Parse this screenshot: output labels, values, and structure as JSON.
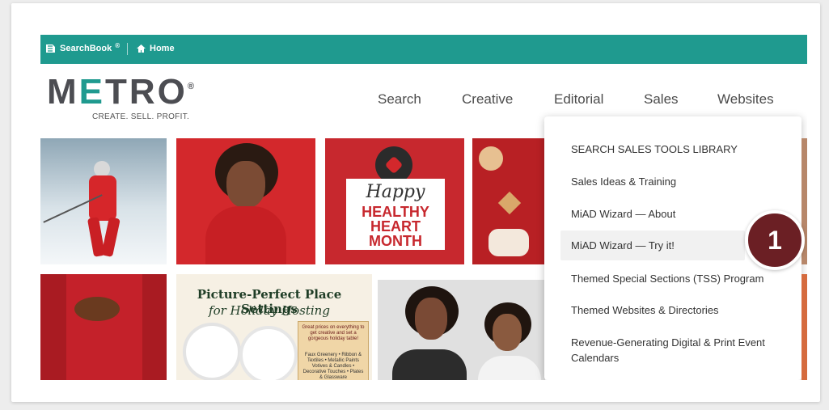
{
  "topbar": {
    "searchbook_label": "SearchBook",
    "searchbook_reg": "®",
    "home_label": "Home"
  },
  "header": {
    "logo_text_left": "M",
    "logo_text_e": "E",
    "logo_text_right": "TRO",
    "logo_reg": "®",
    "tagline": "CREATE. SELL. PROFIT."
  },
  "nav": {
    "items": [
      "Search",
      "Creative",
      "Editorial",
      "Sales",
      "Websites"
    ]
  },
  "dropdown": {
    "items": [
      "SEARCH SALES TOOLS LIBRARY",
      "Sales Ideas & Training",
      "MiAD Wizard — About",
      "MiAD Wizard — Try it!",
      "Themed Special Sections (TSS) Program",
      "Themed Websites & Directories",
      "Revenue-Generating Digital & Print Event Calendars"
    ]
  },
  "tiles": {
    "heart_line1": "Happy",
    "heart_line2": "HEALTHY",
    "heart_line3": "HEART",
    "heart_line4": "MONTH",
    "holiday_title_line1": "Picture-Perfect Place Settings",
    "holiday_title_line2": "for Holiday Hosting",
    "holiday_box_text": "Great prices on everything to get creative and set a gorgeous holiday table!",
    "holiday_list_text": "Faux Greenery • Ribbon & Textiles • Metallic Paints Votives & Candles • Decorative Touches • Plates & Glassware"
  },
  "badge": {
    "number": "1"
  }
}
